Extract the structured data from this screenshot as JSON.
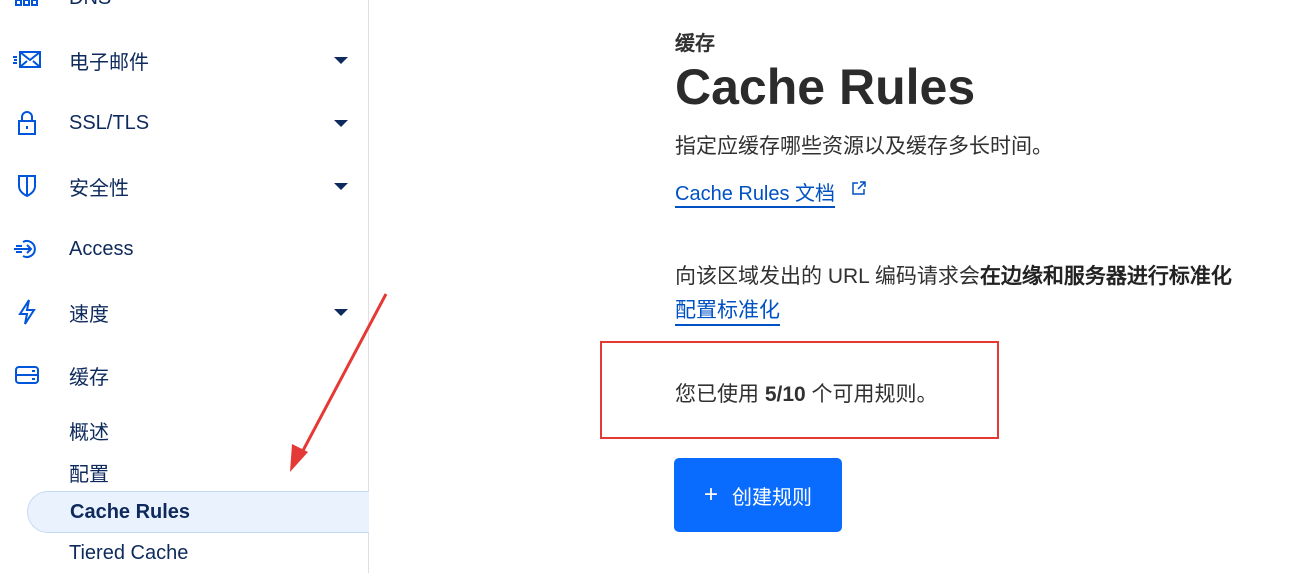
{
  "sidebar": {
    "items": [
      {
        "label": "DNS",
        "icon": "network-icon",
        "caret": true
      },
      {
        "label": "电子邮件",
        "icon": "email-icon",
        "caret": true
      },
      {
        "label": "SSL/TLS",
        "icon": "lock-icon",
        "caret": true
      },
      {
        "label": "安全性",
        "icon": "shield-icon",
        "caret": true
      },
      {
        "label": "Access",
        "icon": "access-icon",
        "caret": false
      },
      {
        "label": "速度",
        "icon": "lightning-icon",
        "caret": true
      },
      {
        "label": "缓存",
        "icon": "storage-icon",
        "caret": true
      }
    ],
    "subitems": [
      {
        "label": "概述"
      },
      {
        "label": "配置"
      },
      {
        "label": "Cache Rules",
        "active": true
      },
      {
        "label": "Tiered Cache"
      }
    ]
  },
  "main": {
    "eyebrow": "缓存",
    "title": "Cache Rules",
    "description": "指定应缓存哪些资源以及缓存多长时间。",
    "docs_link": "Cache Rules 文档",
    "normalization_prefix": "向该区域发出的 URL 编码请求会",
    "normalization_bold": "在边缘和服务器进行标准化",
    "normalization_link": "配置标准化",
    "usage_prefix": "您已使用 ",
    "usage_count": "5/10",
    "usage_suffix": " 个可用规则。",
    "create_button": "创建规则"
  },
  "colors": {
    "accent": "#0a6cff",
    "link": "#0051c3",
    "annotation": "#e53935",
    "nav_text": "#0e2a5c"
  }
}
